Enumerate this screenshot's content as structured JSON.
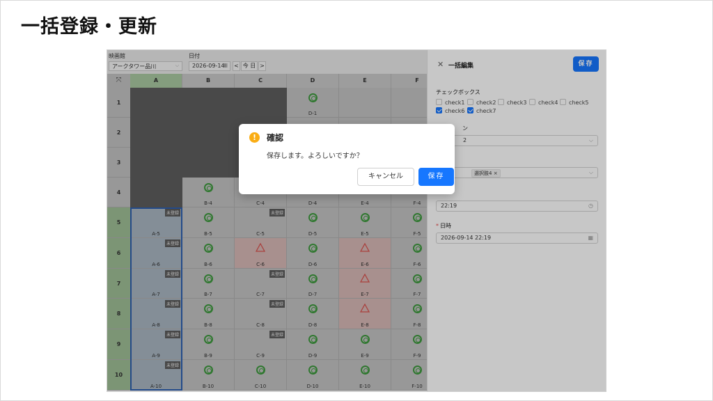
{
  "slide": {
    "title": "一括登録・更新"
  },
  "toolbar": {
    "theater_label": "映画館",
    "theater_value": "アークタワー品川",
    "date_label": "日付",
    "date_value": "2026-09-14",
    "prev": "<",
    "today": "今 日",
    "next": ">"
  },
  "grid": {
    "columns": [
      "A",
      "B",
      "C",
      "D",
      "E",
      "F"
    ],
    "rows": [
      "1",
      "2",
      "3",
      "4",
      "5",
      "6",
      "7",
      "8",
      "9",
      "10"
    ],
    "status_badge": "未登録",
    "cells": {
      "D-1": "D-1",
      "B-4": "B-4",
      "C-4": "C-4",
      "D-4": "D-4",
      "E-4": "E-4",
      "F-4": "F-4",
      "A-5": "A-5",
      "B-5": "B-5",
      "C-5": "C-5",
      "D-5": "D-5",
      "E-5": "E-5",
      "F-5": "F-5",
      "A-6": "A-6",
      "B-6": "B-6",
      "C-6": "C-6",
      "D-6": "D-6",
      "E-6": "E-6",
      "F-6": "F-6",
      "A-7": "A-7",
      "B-7": "B-7",
      "C-7": "C-7",
      "D-7": "D-7",
      "E-7": "E-7",
      "F-7": "F-7",
      "A-8": "A-8",
      "B-8": "B-8",
      "C-8": "C-8",
      "D-8": "D-8",
      "E-8": "E-8",
      "F-8": "F-8",
      "A-9": "A-9",
      "B-9": "B-9",
      "C-9": "C-9",
      "D-9": "D-9",
      "E-9": "E-9",
      "F-9": "F-9",
      "A-10": "A-10",
      "B-10": "B-10",
      "C-10": "C-10",
      "D-10": "D-10",
      "E-10": "E-10",
      "F-10": "F-10"
    }
  },
  "panel": {
    "close": "✕",
    "title": "一括編集",
    "save": "保存",
    "checkbox_label": "チェックボックス",
    "checkboxes": [
      {
        "label": "check1",
        "checked": false
      },
      {
        "label": "check2",
        "checked": false
      },
      {
        "label": "check3",
        "checked": false
      },
      {
        "label": "check4",
        "checked": false
      },
      {
        "label": "check5",
        "checked": false
      },
      {
        "label": "check6",
        "checked": true
      },
      {
        "label": "check7",
        "checked": true
      }
    ],
    "field2_label_partial": "ン",
    "field2_value_partial": "2",
    "tag_value": "選択肢4",
    "tag_remove": "×",
    "time_value": "22:19",
    "datetime_label": "日時",
    "datetime_value": "2026-09-14 22:19",
    "required_mark": "*"
  },
  "modal": {
    "icon": "!",
    "title": "確認",
    "message": "保存します。よろしいですか？",
    "cancel": "キャンセル",
    "ok": "保存"
  },
  "colors": {
    "primary": "#1677ff",
    "warning": "#faad14",
    "ok_mark": "#3e9a3e",
    "ng_mark": "#d9534f",
    "required": "#e34b4b"
  }
}
